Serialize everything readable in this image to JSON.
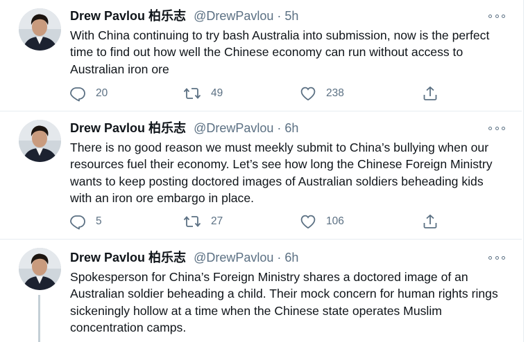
{
  "tweets": [
    {
      "author_name": "Drew Pavlou 柏乐志",
      "handle": "@DrewPavlou",
      "separator": "·",
      "time": "5h",
      "text": "With China continuing to try bash Australia into submission, now is the perfect time to find out how well the Chinese economy can run without access to Australian iron ore",
      "replies": "20",
      "retweets": "49",
      "likes": "238"
    },
    {
      "author_name": "Drew Pavlou 柏乐志",
      "handle": "@DrewPavlou",
      "separator": "·",
      "time": "6h",
      "text": "There is no good reason we must meekly submit to China’s bullying when our resources fuel their economy. Let’s see how long the Chinese Foreign Ministry wants to keep posting doctored images of Australian soldiers beheading kids with an iron ore embargo in place.",
      "replies": "5",
      "retweets": "27",
      "likes": "106"
    },
    {
      "author_name": "Drew Pavlou 柏乐志",
      "handle": "@DrewPavlou",
      "separator": "·",
      "time": "6h",
      "text": "Spokesperson for China’s Foreign Ministry shares a doctored image of an Australian soldier beheading a child. Their mock concern for human rights rings sickeningly hollow at a time when the Chinese state operates Muslim concentration camps."
    }
  ],
  "icons": {
    "reply": "reply-icon",
    "retweet": "retweet-icon",
    "like": "like-icon",
    "share": "share-icon",
    "more": "more-options-icon"
  },
  "colors": {
    "text_primary": "#0f1419",
    "text_secondary": "#5b7083",
    "divider": "#e6ecf0",
    "thread_line": "#c4cfd6"
  }
}
